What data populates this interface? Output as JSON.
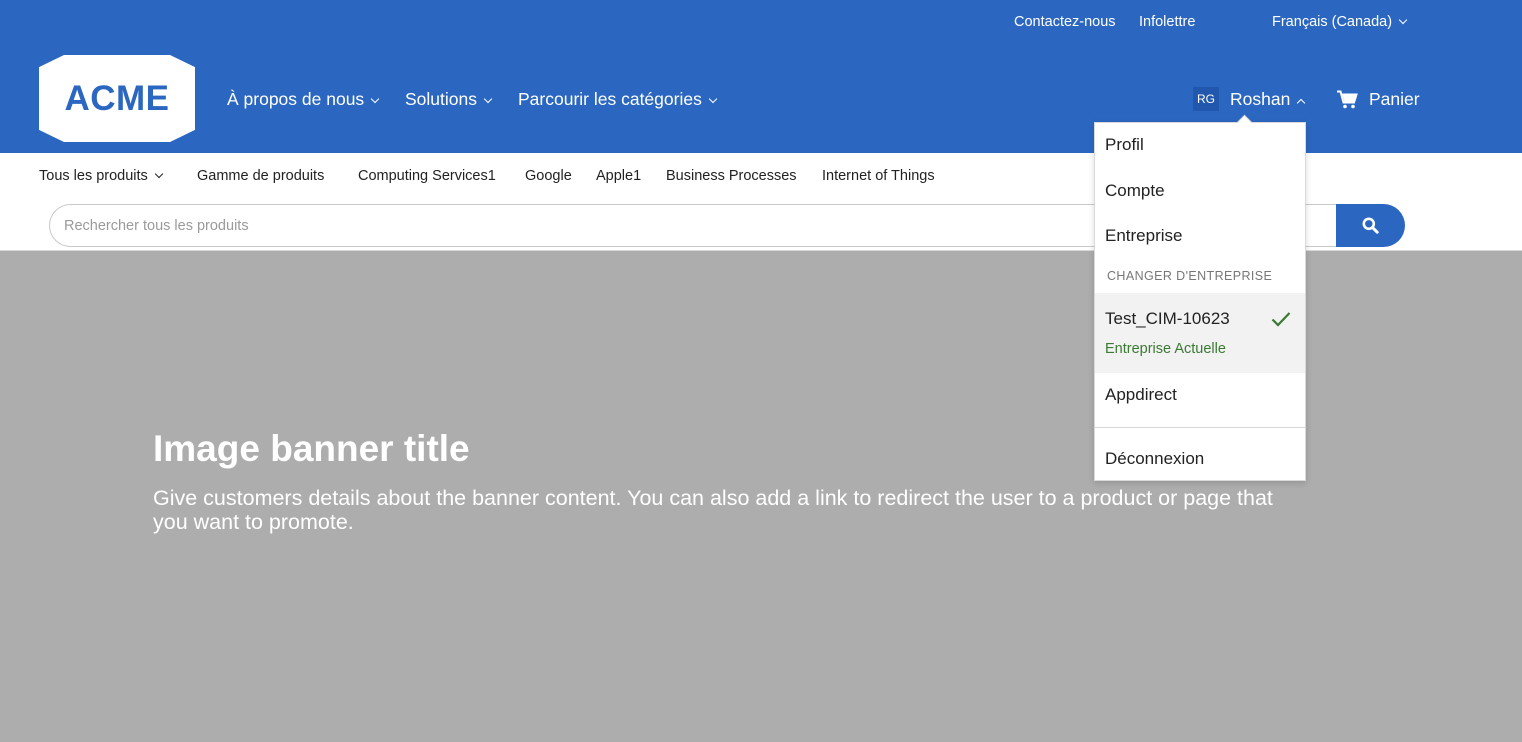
{
  "utility_nav": {
    "contact": "Contactez-nous",
    "newsletter": "Infolettre",
    "language": "Français (Canada)"
  },
  "brand": {
    "logo_text": "ACME"
  },
  "main_nav": {
    "about": "À propos de nous",
    "solutions": "Solutions",
    "categories": "Parcourir les catégories"
  },
  "user": {
    "initials": "RG",
    "name": "Roshan"
  },
  "cart": {
    "label": "Panier"
  },
  "sub_nav": {
    "all_products": "Tous les produits",
    "items": [
      "Gamme de produits",
      "Computing Services1",
      "Google",
      "Apple1",
      "Business Processes",
      "Internet of Things"
    ]
  },
  "search": {
    "placeholder": "Rechercher tous les produits",
    "value": ""
  },
  "banner": {
    "title": "Image banner title",
    "text": "Give customers details about the banner content. You can also add a link to redirect the user to a product or page that you want to promote."
  },
  "user_menu": {
    "profile": "Profil",
    "account": "Compte",
    "company": "Entreprise",
    "switch_heading": "CHANGER D'ENTREPRISE",
    "current_company": {
      "name": "Test_CIM-10623",
      "status": "Entreprise Actuelle"
    },
    "other_company": "Appdirect",
    "logout": "Déconnexion"
  },
  "colors": {
    "brand_blue": "#2b67c0",
    "banner_gray": "#adadad",
    "current_green": "#3a7a32"
  }
}
